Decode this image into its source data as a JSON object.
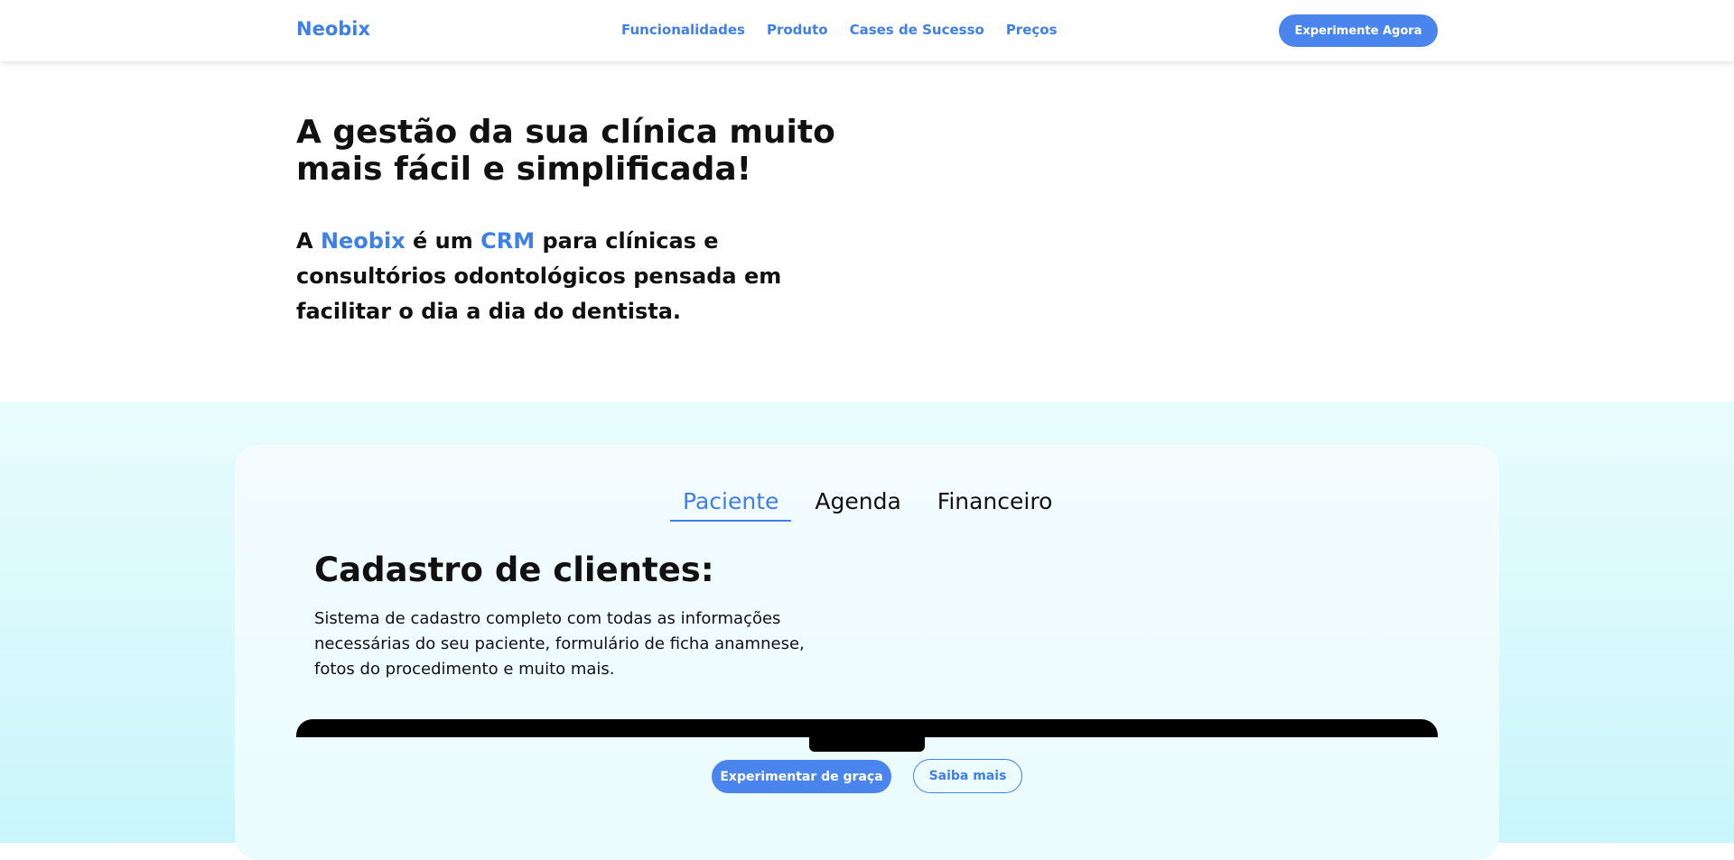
{
  "header": {
    "logo": "Neobix",
    "nav": [
      "Funcionalidades",
      "Produto",
      "Cases de Sucesso",
      "Preços"
    ],
    "cta": "Experimente Agora"
  },
  "hero": {
    "title_line1": "A gestão da sua clínica muito",
    "title_line2": "mais fácil e simplificada!",
    "desc_part1": "A ",
    "desc_brand": "Neobix",
    "desc_part2": " é um ",
    "desc_crm": "CRM",
    "desc_part3": " para clínicas e consultórios odontológicos pensada em facilitar o dia a dia do dentista."
  },
  "features": {
    "tabs": [
      "Paciente",
      "Agenda",
      "Financeiro"
    ],
    "active_tab": "Paciente",
    "title": "Cadastro de clientes:",
    "description": "Sistema de cadastro completo com todas as informações necessárias do seu paciente, formulário de ficha anamnese, fotos do procedimento e muito mais.",
    "primary_button": "Experimentar de graça",
    "secondary_button": "Saiba mais"
  },
  "colors": {
    "accent": "#3f7fe8",
    "button": "#4a85ee",
    "section_bg_top": "#e9fcfd",
    "section_bg_bottom": "#c9f6fb"
  }
}
